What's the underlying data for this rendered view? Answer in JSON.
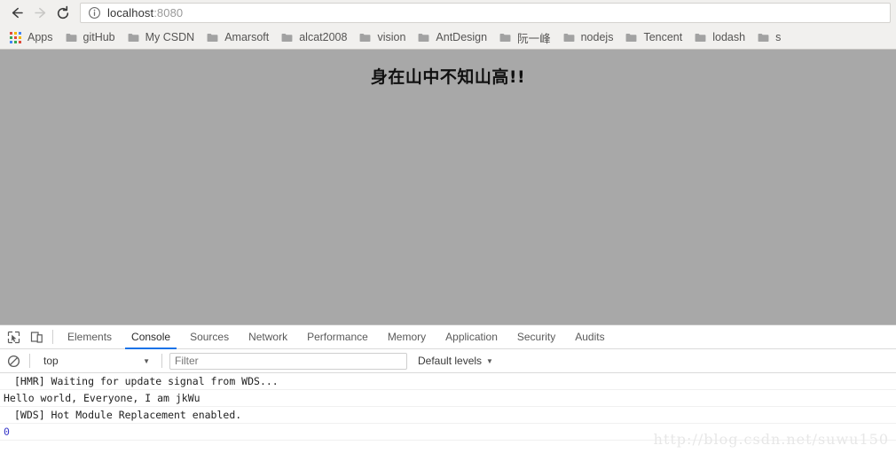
{
  "browser": {
    "nav": {
      "back_icon": "arrow-left-icon",
      "forward_icon": "arrow-right-icon",
      "reload_icon": "reload-icon",
      "back_enabled": true,
      "forward_enabled": false
    },
    "omnibox": {
      "info_icon": "page-info-icon",
      "host": "localhost",
      "port": ":8080"
    },
    "bookmarks": {
      "apps_label": "Apps",
      "apps_icon": "apps-grid-icon",
      "apps_colors": [
        "#e04b3a",
        "#f2b500",
        "#4285f4",
        "#34a853",
        "#e04b3a",
        "#f2b500",
        "#4285f4",
        "#34a853",
        "#e04b3a"
      ],
      "items": [
        {
          "label": "gitHub",
          "icon": "folder-icon"
        },
        {
          "label": "My CSDN",
          "icon": "folder-icon"
        },
        {
          "label": "Amarsoft",
          "icon": "folder-icon"
        },
        {
          "label": "alcat2008",
          "icon": "folder-icon"
        },
        {
          "label": "vision",
          "icon": "folder-icon"
        },
        {
          "label": "AntDesign",
          "icon": "folder-icon"
        },
        {
          "label": "阮一峰",
          "icon": "folder-icon"
        },
        {
          "label": "nodejs",
          "icon": "folder-icon"
        },
        {
          "label": "Tencent",
          "icon": "folder-icon"
        },
        {
          "label": "lodash",
          "icon": "folder-icon"
        },
        {
          "label": "s",
          "icon": "folder-icon"
        }
      ]
    }
  },
  "page": {
    "background_color": "#a8a8a8",
    "heading": "身在山中不知山高!!"
  },
  "devtools": {
    "inspect_icon": "inspect-element-icon",
    "device_icon": "device-toolbar-icon",
    "tabs": [
      {
        "label": "Elements",
        "active": false
      },
      {
        "label": "Console",
        "active": true
      },
      {
        "label": "Sources",
        "active": false
      },
      {
        "label": "Network",
        "active": false
      },
      {
        "label": "Performance",
        "active": false
      },
      {
        "label": "Memory",
        "active": false
      },
      {
        "label": "Application",
        "active": false
      },
      {
        "label": "Security",
        "active": false
      },
      {
        "label": "Audits",
        "active": false
      }
    ],
    "active_tab_color": "#1a73e8",
    "console_toolbar": {
      "clear_icon": "clear-console-icon",
      "context_value": "top",
      "filter_value": "",
      "filter_placeholder": "Filter",
      "levels_label": "Default levels",
      "caret_icon": "chevron-down-icon"
    },
    "console_messages": [
      {
        "text": "[HMR] Waiting for update signal from WDS...",
        "type": "log",
        "indent": true
      },
      {
        "text": "Hello world, Everyone, I am jkWu",
        "type": "log",
        "indent": false
      },
      {
        "text": "[WDS] Hot Module Replacement enabled.",
        "type": "log",
        "indent": true
      },
      {
        "text": "0",
        "type": "result",
        "indent": false
      }
    ]
  },
  "watermark": {
    "text": "http://blog.csdn.net/suwu150"
  }
}
